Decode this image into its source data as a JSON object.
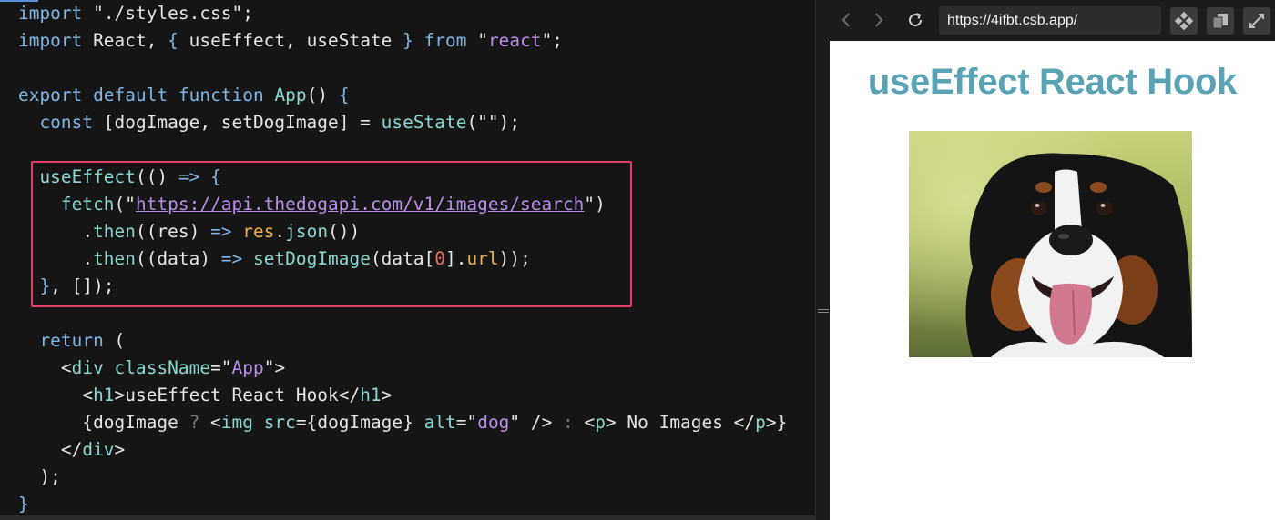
{
  "editor": {
    "lines": [
      [
        {
          "t": "import",
          "c": "kw"
        },
        {
          "t": " ",
          "c": "var"
        },
        {
          "t": "\"./styles.css\"",
          "c": "str"
        },
        {
          "t": ";",
          "c": "var"
        }
      ],
      [
        {
          "t": "import",
          "c": "kw"
        },
        {
          "t": " React, ",
          "c": "var"
        },
        {
          "t": "{",
          "c": "kw"
        },
        {
          "t": " useEffect, useState ",
          "c": "var"
        },
        {
          "t": "}",
          "c": "kw"
        },
        {
          "t": " ",
          "c": "var"
        },
        {
          "t": "from",
          "c": "kw"
        },
        {
          "t": " \"",
          "c": "var"
        },
        {
          "t": "react",
          "c": "strc"
        },
        {
          "t": "\";",
          "c": "var"
        }
      ],
      [],
      [
        {
          "t": "export",
          "c": "kw"
        },
        {
          "t": " ",
          "c": "var"
        },
        {
          "t": "default",
          "c": "kw"
        },
        {
          "t": " ",
          "c": "var"
        },
        {
          "t": "function",
          "c": "kw"
        },
        {
          "t": " ",
          "c": "var"
        },
        {
          "t": "App",
          "c": "fn"
        },
        {
          "t": "() ",
          "c": "var"
        },
        {
          "t": "{",
          "c": "kw"
        }
      ],
      [
        {
          "t": "  ",
          "c": "var"
        },
        {
          "t": "const",
          "c": "kw"
        },
        {
          "t": " [dogImage, setDogImage] = ",
          "c": "var"
        },
        {
          "t": "useState",
          "c": "fn"
        },
        {
          "t": "(\"\");",
          "c": "var"
        }
      ],
      [],
      [
        {
          "t": "  ",
          "c": "var"
        },
        {
          "t": "useEffect",
          "c": "fn"
        },
        {
          "t": "(() ",
          "c": "var"
        },
        {
          "t": "=>",
          "c": "kw"
        },
        {
          "t": " ",
          "c": "var"
        },
        {
          "t": "{",
          "c": "kw"
        }
      ],
      [
        {
          "t": "    ",
          "c": "var"
        },
        {
          "t": "fetch",
          "c": "fn"
        },
        {
          "t": "(\"",
          "c": "var"
        },
        {
          "t": "https://api.thedogapi.com/v1/images/search",
          "c": "url"
        },
        {
          "t": "\")",
          "c": "var"
        }
      ],
      [
        {
          "t": "      .",
          "c": "var"
        },
        {
          "t": "then",
          "c": "fn"
        },
        {
          "t": "((res) ",
          "c": "var"
        },
        {
          "t": "=>",
          "c": "kw"
        },
        {
          "t": " ",
          "c": "var"
        },
        {
          "t": "res",
          "c": "prop"
        },
        {
          "t": ".",
          "c": "var"
        },
        {
          "t": "json",
          "c": "fn"
        },
        {
          "t": "())",
          "c": "var"
        }
      ],
      [
        {
          "t": "      .",
          "c": "var"
        },
        {
          "t": "then",
          "c": "fn"
        },
        {
          "t": "((data) ",
          "c": "var"
        },
        {
          "t": "=>",
          "c": "kw"
        },
        {
          "t": " ",
          "c": "var"
        },
        {
          "t": "setDogImage",
          "c": "fn"
        },
        {
          "t": "(data[",
          "c": "var"
        },
        {
          "t": "0",
          "c": "num"
        },
        {
          "t": "].",
          "c": "var"
        },
        {
          "t": "url",
          "c": "prop"
        },
        {
          "t": "));",
          "c": "var"
        }
      ],
      [
        {
          "t": "  ",
          "c": "var"
        },
        {
          "t": "}",
          "c": "kw"
        },
        {
          "t": ", []);",
          "c": "var"
        }
      ],
      [],
      [
        {
          "t": "  ",
          "c": "var"
        },
        {
          "t": "return",
          "c": "kw"
        },
        {
          "t": " (",
          "c": "var"
        }
      ],
      [
        {
          "t": "    <",
          "c": "var"
        },
        {
          "t": "div",
          "c": "tag"
        },
        {
          "t": " ",
          "c": "var"
        },
        {
          "t": "className",
          "c": "attr"
        },
        {
          "t": "=\"",
          "c": "var"
        },
        {
          "t": "App",
          "c": "strc"
        },
        {
          "t": "\">",
          "c": "var"
        }
      ],
      [
        {
          "t": "      <",
          "c": "var"
        },
        {
          "t": "h1",
          "c": "tag"
        },
        {
          "t": ">useEffect React Hook</",
          "c": "var"
        },
        {
          "t": "h1",
          "c": "tag"
        },
        {
          "t": ">",
          "c": "var"
        }
      ],
      [
        {
          "t": "      {dogImage ",
          "c": "var"
        },
        {
          "t": "?",
          "c": "dim"
        },
        {
          "t": " <",
          "c": "var"
        },
        {
          "t": "img",
          "c": "tag"
        },
        {
          "t": " ",
          "c": "var"
        },
        {
          "t": "src",
          "c": "attr"
        },
        {
          "t": "={dogImage} ",
          "c": "var"
        },
        {
          "t": "alt",
          "c": "attr"
        },
        {
          "t": "=\"",
          "c": "var"
        },
        {
          "t": "dog",
          "c": "strc"
        },
        {
          "t": "\" /> ",
          "c": "var"
        },
        {
          "t": ":",
          "c": "dim"
        },
        {
          "t": " <",
          "c": "var"
        },
        {
          "t": "p",
          "c": "tag"
        },
        {
          "t": "> No Images </",
          "c": "var"
        },
        {
          "t": "p",
          "c": "tag"
        },
        {
          "t": ">}",
          "c": "var"
        }
      ],
      [
        {
          "t": "    </",
          "c": "var"
        },
        {
          "t": "div",
          "c": "tag"
        },
        {
          "t": ">",
          "c": "var"
        }
      ],
      [
        {
          "t": "  );",
          "c": "var"
        }
      ],
      [
        {
          "t": "}",
          "c": "kw"
        }
      ]
    ]
  },
  "browser": {
    "url": "https://4ifbt.csb.app/",
    "back_icon": "chevron-left-icon",
    "forward_icon": "chevron-right-icon",
    "reload_icon": "reload-icon",
    "page_title": "useEffect React Hook",
    "image_alt": "dog"
  },
  "colors": {
    "highlight_border": "#e33e6a",
    "title": "#5aa3b5",
    "editor_bg": "#151515"
  }
}
